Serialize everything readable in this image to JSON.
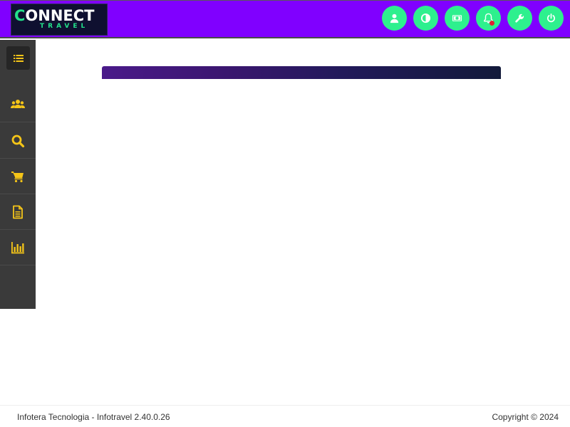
{
  "header": {
    "logo_main": "ONNECT",
    "logo_c": "C",
    "logo_sub": "TRAVEL",
    "accent_color": "#8000ff",
    "button_color": "#2ef08e",
    "buttons": [
      {
        "name": "profile-button",
        "icon": "user-icon"
      },
      {
        "name": "theme-button",
        "icon": "contrast-icon"
      },
      {
        "name": "currency-button",
        "icon": "money-icon"
      },
      {
        "name": "notifications-button",
        "icon": "bell-icon"
      },
      {
        "name": "settings-button",
        "icon": "wrench-icon"
      },
      {
        "name": "logout-button",
        "icon": "power-icon"
      }
    ]
  },
  "sidebar": {
    "toggle_icon": "list-icon",
    "icon_color": "#f5c518",
    "items": [
      {
        "name": "sidebar-item-clients",
        "icon": "users-icon"
      },
      {
        "name": "sidebar-item-search",
        "icon": "search-icon"
      },
      {
        "name": "sidebar-item-cart",
        "icon": "cart-icon"
      },
      {
        "name": "sidebar-item-documents",
        "icon": "document-icon"
      },
      {
        "name": "sidebar-item-reports",
        "icon": "bar-chart-icon"
      }
    ]
  },
  "footer": {
    "left_text": "Infotera Tecnologia - Infotravel 2.40.0.26",
    "right_text": "Copyright © 2024"
  }
}
